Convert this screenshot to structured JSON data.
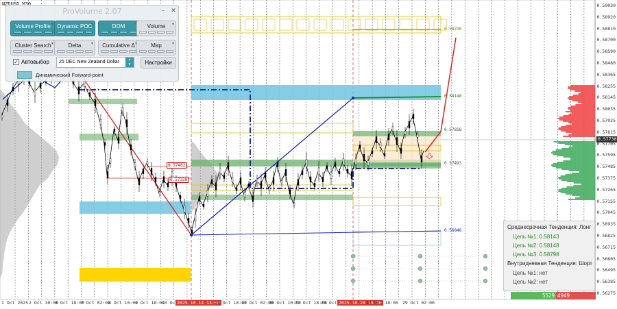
{
  "chart": {
    "symbol": "NZDUSD,M30",
    "current_price": "0.57730",
    "price_ticks": [
      "0.59030",
      "0.58920",
      "0.58810",
      "0.58700",
      "0.58590",
      "0.58480",
      "0.58365",
      "0.58255",
      "0.58145",
      "0.58035",
      "0.57925",
      "0.57815",
      "0.57705",
      "0.57595",
      "0.57485",
      "0.57375",
      "0.57265",
      "0.57155",
      "0.57045",
      "0.56935",
      "0.56825",
      "0.56715",
      "0.56605",
      "0.56495",
      "0.56385",
      "0.56275"
    ],
    "time_ticks": [
      {
        "label": "1 Oct 2025",
        "hl": false
      },
      {
        "label": "2 Oct 10:00",
        "hl": false
      },
      {
        "label": "3 Oct 18:00",
        "hl": false
      },
      {
        "label": "7 Oct 02:00",
        "hl": false
      },
      {
        "label": "8 Oct 10:00",
        "hl": false
      },
      {
        "label": "9 Oct 18:00",
        "hl": false
      },
      {
        "label": "13 Oct",
        "hl": false
      },
      {
        "label": "2025.10.14 13:00",
        "hl": true
      },
      {
        "label": "15 Oct 18:00",
        "hl": false
      },
      {
        "label": "17 Oct 02:00",
        "hl": false
      },
      {
        "label": "20 Oct 10:00",
        "hl": false
      },
      {
        "label": "21 Oct 18:00",
        "hl": false
      },
      {
        "label": "23 Oct",
        "hl": false
      },
      {
        "label": "2025.10.24 15:30",
        "hl": true
      },
      {
        "label": "27 Oct 18:00",
        "hl": false
      },
      {
        "label": "29 Oct 02:00",
        "hl": false
      }
    ],
    "level_labels": {
      "l1": "0.58798",
      "l2": "0.58148",
      "l3": "0.57818",
      "l4": "0.57493",
      "l5": "0.56848",
      "r1": "0.57482",
      "r2": "0.57330"
    },
    "colors": {
      "up_candle": "#000000",
      "poc_zone": "#70c4e0",
      "green_zone": "#6aaf6a",
      "yellow_zone": "#ffd400",
      "trend_blue": "#1520c8",
      "trend_red": "#e02020",
      "profile_grey": "#a8a8a8",
      "profile_red": "#f04040",
      "profile_green": "#3caa5a"
    }
  },
  "provolume": {
    "title": "ProVolume 2.07",
    "buttons": [
      {
        "label": "Volume Profile",
        "active": true
      },
      {
        "label": "Dynamic POC",
        "active": true
      },
      {
        "label": "DOM",
        "active": true
      },
      {
        "label": "Volume",
        "active": false
      },
      {
        "label": "Cluster Search",
        "active": false
      },
      {
        "label": "Delta",
        "active": false
      },
      {
        "label": "Cumulative Δ",
        "active": false
      },
      {
        "label": "Map",
        "active": false
      }
    ],
    "auto_select_label": "Автовыбор",
    "auto_select_checked": true,
    "instrument": "25 DEC New Zealand Dollar",
    "settings_label": "Настройки",
    "forward_point_label": "Динамический Forward-point"
  },
  "trend": {
    "mid_title": "Среднесрочная Тенденция: Лонг",
    "mid_targets": [
      "Цель №1: 0.58143",
      "Цель №2: 0.58148",
      "Цель №3: 0.58798"
    ],
    "intraday_title": "Внутридневная Тенденция: Шорт",
    "intraday_targets": [
      "Цель №1: нет",
      "Цель №2: нет"
    ]
  },
  "volume_balance": {
    "buy": "5529",
    "sell": "4949"
  }
}
